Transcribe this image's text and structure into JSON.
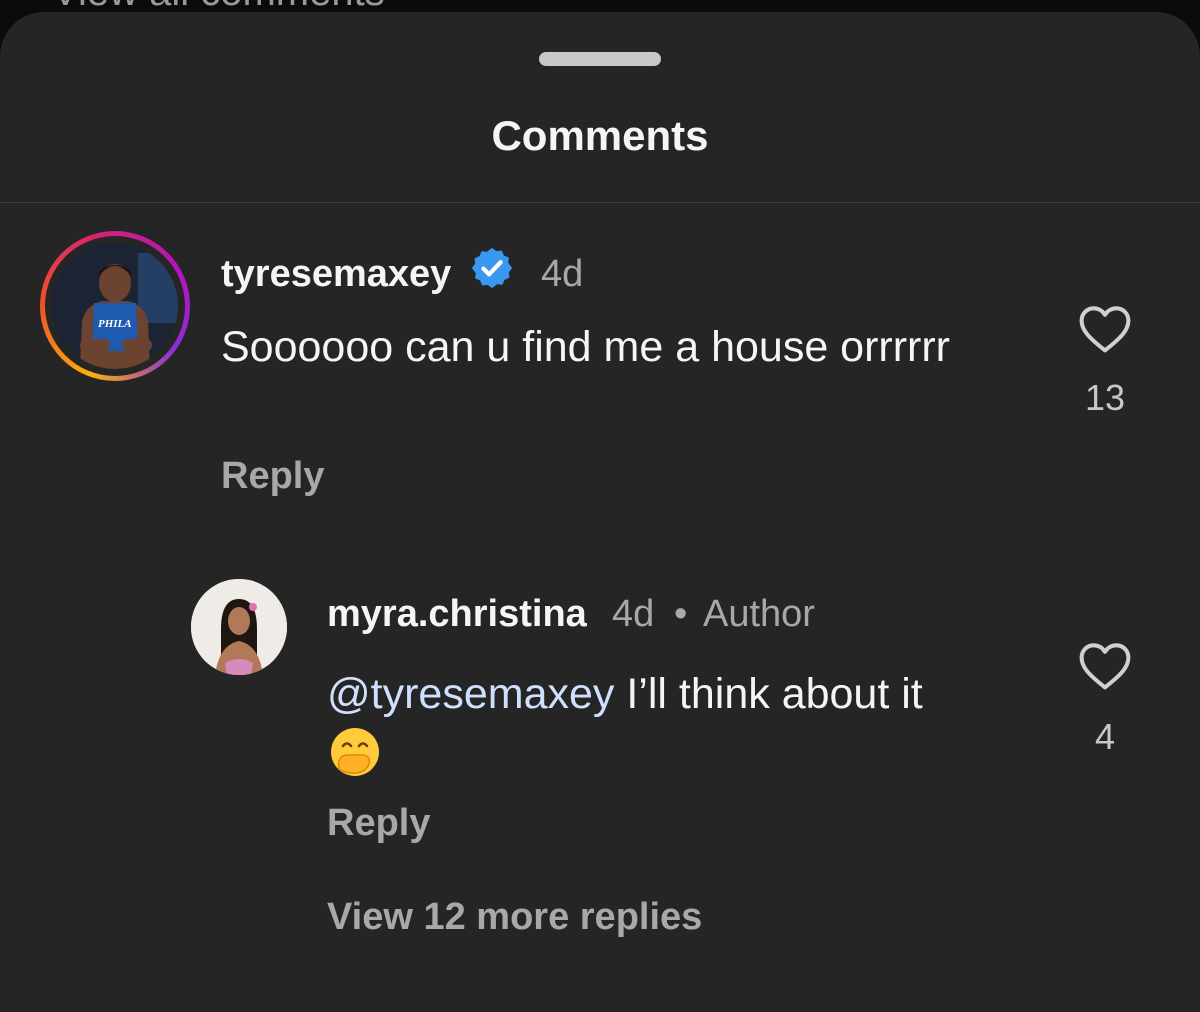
{
  "background_peek_text": "View all comments",
  "sheet": {
    "title": "Comments"
  },
  "comments": [
    {
      "username": "tyresemaxey",
      "verified": true,
      "time": "4d",
      "text": "Soooooo can u find me a house orrrrrr",
      "reply_label": "Reply",
      "like_count": "13",
      "avatar_jersey_text": "PHILA"
    },
    {
      "username": "myra.christina",
      "time": "4d",
      "separator": "•",
      "badge": "Author",
      "mention": "@tyresemaxey",
      "text": "I’ll think about it",
      "emoji": "hand-over-mouth-emoji",
      "reply_label": "Reply",
      "like_count": "4",
      "view_more": "View 12 more replies"
    }
  ],
  "colors": {
    "sheet_bg": "#252525",
    "text_primary": "#f5f5f5",
    "text_secondary": "#a8a8a8",
    "verified_blue": "#3897f0"
  }
}
